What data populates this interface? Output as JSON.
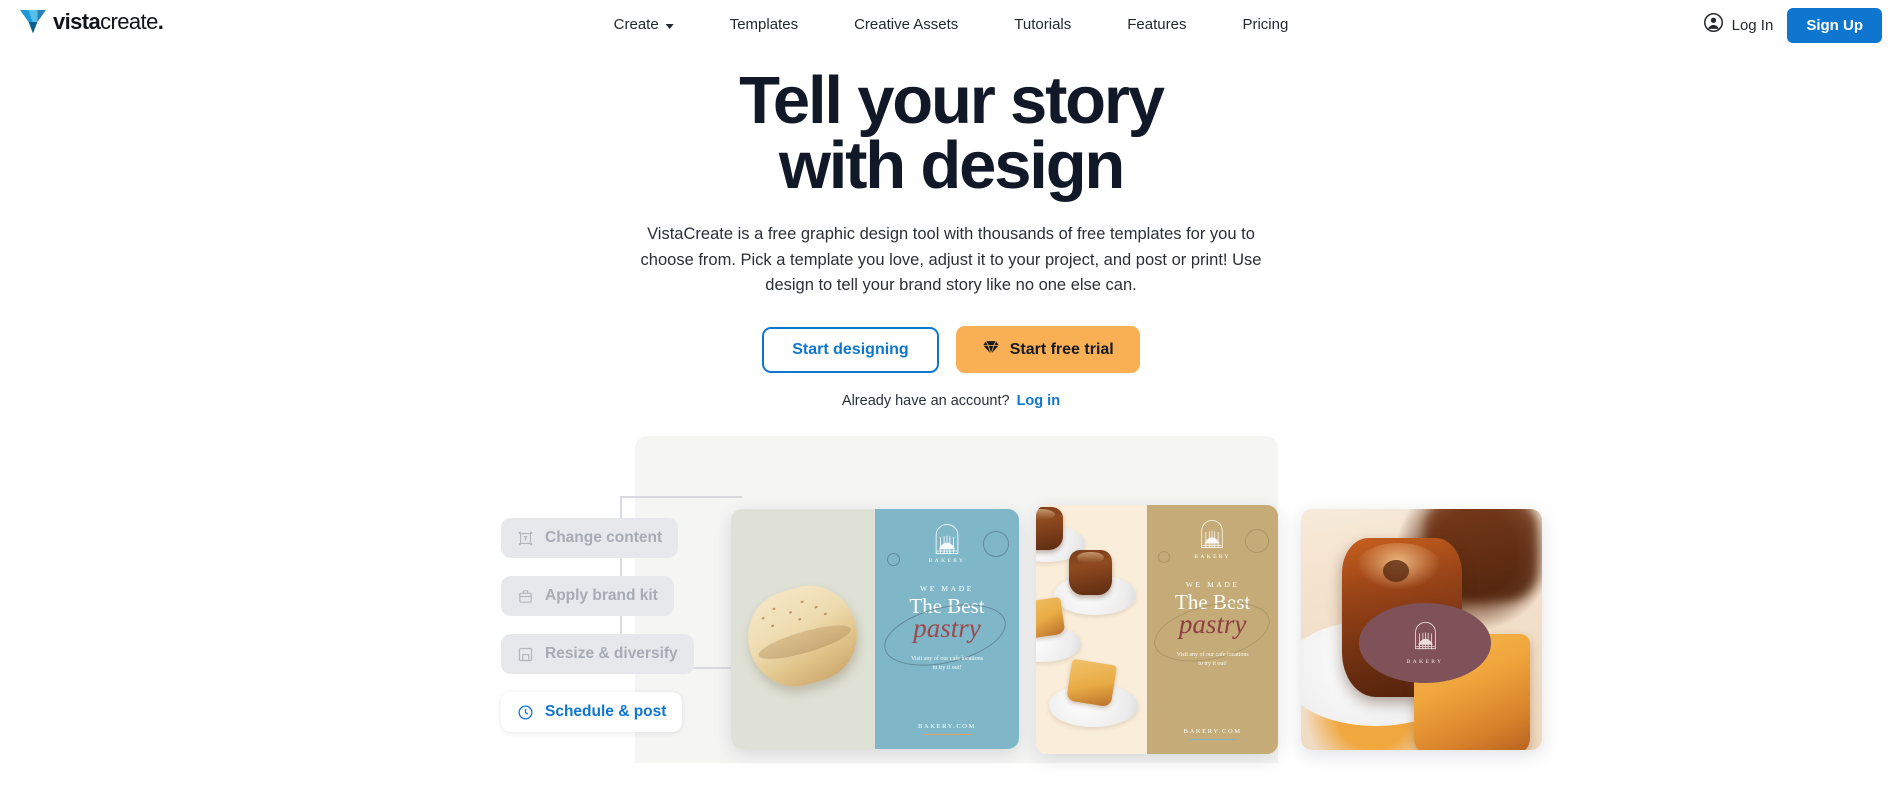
{
  "brand": {
    "logo_text_bold": "vista",
    "logo_text_light": "create",
    "logo_dot": ".",
    "logo_icon": "vista-v-logo"
  },
  "header": {
    "nav": [
      {
        "label": "Create",
        "has_caret": true
      },
      {
        "label": "Templates",
        "has_caret": false
      },
      {
        "label": "Creative Assets",
        "has_caret": false
      },
      {
        "label": "Tutorials",
        "has_caret": false
      },
      {
        "label": "Features",
        "has_caret": false
      },
      {
        "label": "Pricing",
        "has_caret": false
      }
    ],
    "login_label": "Log In",
    "login_icon": "user-circle-icon",
    "signup_label": "Sign Up",
    "signup_color": "#0f76d0"
  },
  "hero": {
    "title_line1": "Tell your story",
    "title_line2": "with design",
    "paragraph": "VistaCreate is a free graphic design tool with thousands of free templates for you to choose from. Pick a template you love, adjust it to your project, and post or print! Use design to tell your brand story like no one else can.",
    "primary_cta": "Start designing",
    "secondary_cta": "Start free trial",
    "secondary_cta_icon": "diamond-icon",
    "secondary_cta_color": "#f9b054",
    "account_prompt": "Already have an account?",
    "account_link": "Log in"
  },
  "showcase": {
    "steps": [
      {
        "label": "Change content",
        "icon": "text-box-icon",
        "active": false
      },
      {
        "label": "Apply brand kit",
        "icon": "briefcase-icon",
        "active": false
      },
      {
        "label": "Resize & diversify",
        "icon": "resize-icon",
        "active": false
      },
      {
        "label": "Schedule & post",
        "icon": "clock-icon",
        "active": true
      }
    ],
    "cards": [
      {
        "name": "bakery-template-landscape",
        "panel_color": "#7fb7c8",
        "logo_word": "BAKERY",
        "eyebrow": "WE MADE",
        "headline": "The Best",
        "script": "pastry",
        "tagline_line1": "Visit any of our cafe locations",
        "tagline_line2": "to try it out!",
        "url": "BAKERY.COM"
      },
      {
        "name": "bakery-template-portrait",
        "panel_color": "#c4ab77",
        "logo_word": "BAKERY",
        "eyebrow": "WE MADE",
        "headline": "The Best",
        "script": "pastry",
        "tagline_line1": "Visit any of our cafe locations",
        "tagline_line2": "to try it out!",
        "url": "BAKERY.COM"
      },
      {
        "name": "bakery-template-photo",
        "badge_color": "#7f5259",
        "logo_word": "BAKERY"
      }
    ]
  }
}
